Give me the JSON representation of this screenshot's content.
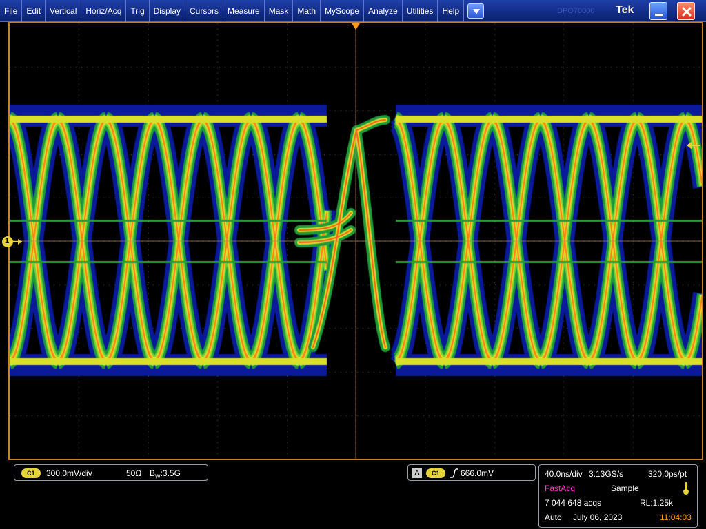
{
  "menu": {
    "items": [
      "File",
      "Edit",
      "Vertical",
      "Horiz/Acq",
      "Trig",
      "Display",
      "Cursors",
      "Measure",
      "Mask",
      "Math",
      "MyScope",
      "Analyze",
      "Utilities",
      "Help"
    ],
    "brand": "Tek",
    "ghost_text": "DPO70000"
  },
  "icons": {
    "dropdown": "chevron-down-icon",
    "minimize": "minimize-icon",
    "close": "close-icon",
    "trigger_position": "trigger-position-marker-icon",
    "channel_reference": "ch1-reference-marker-icon",
    "trigger_level": "trigger-level-marker-icon",
    "rising_edge": "rising-edge-icon",
    "acquisition_status": "thermometer-icon"
  },
  "colors": {
    "ch1": "#e7d43a",
    "fastacq": "#ff33cc",
    "time": "#ff9a1a",
    "frame": "#c9812a",
    "menubar": "#0a1f6e"
  },
  "display": {
    "ch1_marker_label": "1"
  },
  "ch1_readout": {
    "badge": "C1",
    "scale": "300.0mV/div",
    "termination": "50Ω",
    "bw_label": "B",
    "bw_sub": "W",
    "bw_value": ":3.5G"
  },
  "trigger_readout": {
    "source_letter": "A",
    "badge": "C1",
    "level": "666.0mV"
  },
  "acq_readout": {
    "timebase": "40.0ns/div",
    "sample_rate": "3.13GS/s",
    "resolution": "320.0ps/pt",
    "mode": "FastAcq",
    "sample_mode": "Sample",
    "acqs": "7 044 648 acqs",
    "record_length": "RL:1.25k",
    "trigger_mode": "Auto",
    "date": "July 06, 2023",
    "time": "11:04:03"
  }
}
